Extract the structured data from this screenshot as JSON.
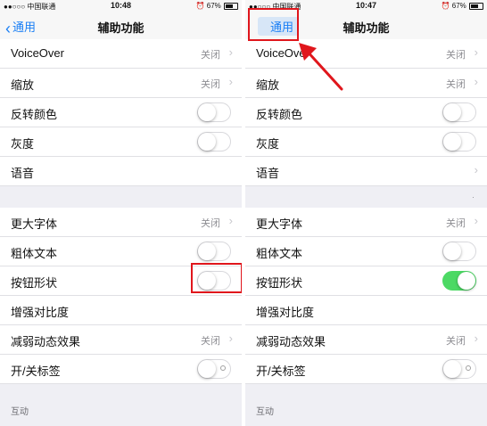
{
  "colors": {
    "accent": "#1a7ff5",
    "toggle_on": "#4cd964",
    "highlight": "#e0161c"
  },
  "left": {
    "status": {
      "carrier": "●●○○○ 中国联通",
      "time": "10:48",
      "battery": "67%"
    },
    "nav": {
      "back": "通用",
      "title": "辅助功能"
    },
    "rows": {
      "voiceover": {
        "label": "VoiceOver",
        "value": "关闭"
      },
      "zoom": {
        "label": "缩放",
        "value": "关闭"
      },
      "invert": {
        "label": "反转颜色",
        "toggle": false
      },
      "grayscale": {
        "label": "灰度",
        "toggle": false
      },
      "speech": {
        "label": "语音"
      },
      "larger_text": {
        "label": "更大字体",
        "value": "关闭"
      },
      "bold_text": {
        "label": "粗体文本",
        "toggle": false
      },
      "button_shapes": {
        "label": "按钮形状",
        "toggle": false
      },
      "contrast": {
        "label": "增强对比度"
      },
      "reduce_motion": {
        "label": "减弱动态效果",
        "value": "关闭"
      },
      "onoff_labels": {
        "label": "开/关标签",
        "toggle": false
      }
    },
    "interaction_header": "互动"
  },
  "right": {
    "status": {
      "carrier": "●●○○○ 中国联通",
      "time": "10:47",
      "battery": "67%"
    },
    "nav": {
      "back": "通用",
      "title": "辅助功能"
    },
    "rows": {
      "voiceover": {
        "label": "VoiceOver",
        "value": "关闭"
      },
      "zoom": {
        "label": "缩放",
        "value": "关闭"
      },
      "invert": {
        "label": "反转颜色",
        "toggle": false
      },
      "grayscale": {
        "label": "灰度",
        "toggle": false
      },
      "speech": {
        "label": "语音"
      },
      "larger_text": {
        "label": "更大字体",
        "value": "关闭"
      },
      "bold_text": {
        "label": "粗体文本",
        "toggle": false
      },
      "button_shapes": {
        "label": "按钮形状",
        "toggle": true
      },
      "contrast": {
        "label": "增强对比度"
      },
      "reduce_motion": {
        "label": "减弱动态效果",
        "value": "关闭"
      },
      "onoff_labels": {
        "label": "开/关标签",
        "toggle": false
      }
    },
    "interaction_header": "互动"
  }
}
